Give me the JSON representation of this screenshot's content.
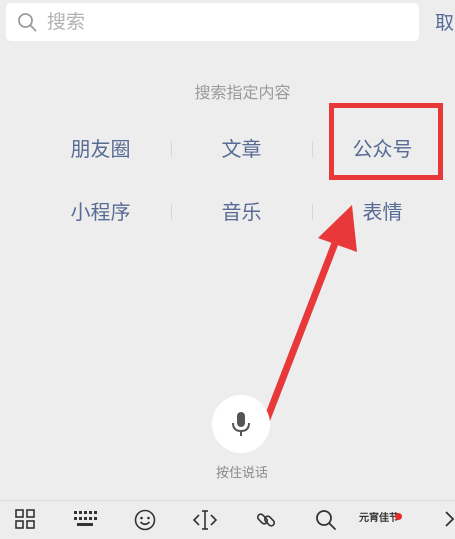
{
  "search": {
    "placeholder": "搜索",
    "cancel_label": "取消"
  },
  "section": {
    "title": "搜索指定内容"
  },
  "categories": {
    "row1": [
      "朋友圈",
      "文章",
      "公众号"
    ],
    "row2": [
      "小程序",
      "音乐",
      "表情"
    ]
  },
  "voice": {
    "label": "按住说话"
  },
  "keyboard_toolbar": {
    "brand_text": "元宵佳节",
    "items": [
      "grid-icon",
      "keyboard-icon",
      "emoji-icon",
      "cursor-move-icon",
      "link-icon",
      "search-icon",
      "chevron-right-icon"
    ]
  },
  "colors": {
    "link": "#576b95",
    "annotation_red": "#e8383a",
    "background": "#ededed"
  }
}
